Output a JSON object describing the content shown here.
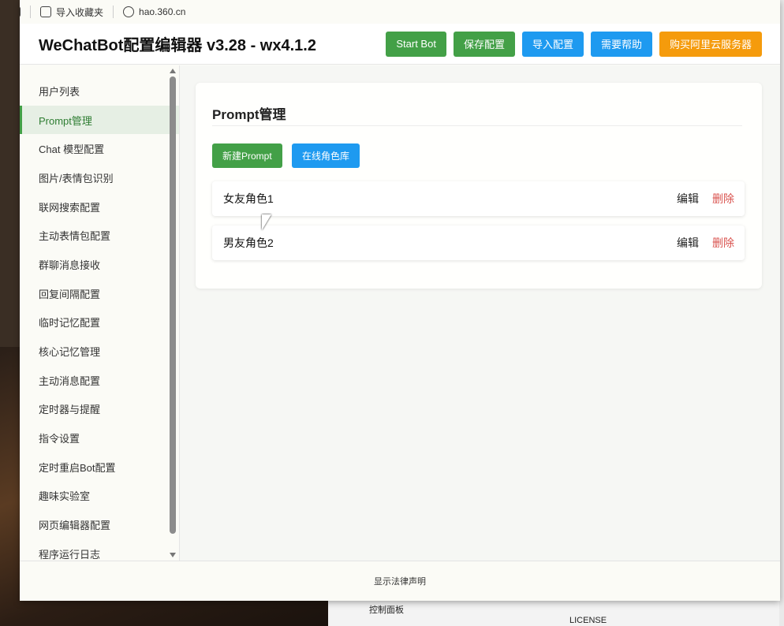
{
  "browser": {
    "import_bookmarks": "导入收藏夹",
    "url": "hao.360.cn"
  },
  "app": {
    "title": "WeChatBot配置编辑器 v3.28 - wx4.1.2"
  },
  "header_actions": {
    "start_bot": "Start Bot",
    "save_config": "保存配置",
    "import_config": "导入配置",
    "need_help": "需要帮助",
    "buy_server": "购买阿里云服务器"
  },
  "sidebar": {
    "items": [
      {
        "label": "用户列表"
      },
      {
        "label": "Prompt管理"
      },
      {
        "label": "Chat 模型配置"
      },
      {
        "label": "图片/表情包识别"
      },
      {
        "label": "联网搜索配置"
      },
      {
        "label": "主动表情包配置"
      },
      {
        "label": "群聊消息接收"
      },
      {
        "label": "回复间隔配置"
      },
      {
        "label": "临时记忆配置"
      },
      {
        "label": "核心记忆管理"
      },
      {
        "label": "主动消息配置"
      },
      {
        "label": "定时器与提醒"
      },
      {
        "label": "指令设置"
      },
      {
        "label": "定时重启Bot配置"
      },
      {
        "label": "趣味实验室"
      },
      {
        "label": "网页编辑器配置"
      },
      {
        "label": "程序运行日志"
      }
    ],
    "active_index": 1
  },
  "main": {
    "section_title": "Prompt管理",
    "new_prompt": "新建Prompt",
    "online_library": "在线角色库",
    "prompts": [
      {
        "name": "女友角色1",
        "edit": "编辑",
        "delete": "删除"
      },
      {
        "name": "男友角色2",
        "edit": "编辑",
        "delete": "删除"
      }
    ]
  },
  "footer": {
    "legal": "显示法律声明"
  },
  "background": {
    "explorer_items": [
      "控制面板",
      "LICENSE"
    ]
  },
  "colors": {
    "green": "#43a047",
    "blue": "#1e9af0",
    "orange": "#f59b0c",
    "delete_red": "#d9534f"
  }
}
